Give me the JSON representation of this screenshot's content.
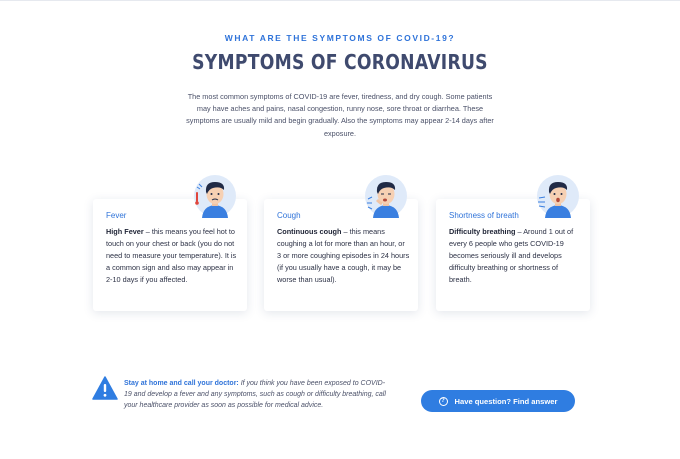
{
  "header": {
    "eyebrow": "WHAT ARE THE SYMPTOMS OF COVID-19?",
    "title": "SYMPTOMS OF CORONAVIRUS",
    "intro": "The most common symptoms of COVID-19 are fever, tiredness, and dry cough. Some patients may have aches and pains, nasal congestion, runny nose, sore throat or diarrhea. These symptoms are usually mild and begin gradually. Also the symptoms may appear 2-14 days after exposure."
  },
  "cards": [
    {
      "title": "Fever",
      "lead": "High Fever",
      "text": " – this means you feel hot to touch on your chest or back (you do not need to measure your temperature). It is a common sign and also may appear in 2-10 days if you affected.",
      "icon": "fever-avatar-icon"
    },
    {
      "title": "Cough",
      "lead": "Continuous cough",
      "text": " – this means coughing a lot for more than an hour, or 3 or more coughing episodes in 24 hours (if you usually have a cough, it may be worse than usual).",
      "icon": "cough-avatar-icon"
    },
    {
      "title": "Shortness of breath",
      "lead": "Difficulty breathing",
      "text": " – Around 1 out of every 6 people who gets COVID-19 becomes seriously ill and develops difficulty breathing or shortness of breath.",
      "icon": "breathing-avatar-icon"
    }
  ],
  "notice": {
    "lead": "Stay at home and call your doctor:",
    "text": " If you think you have been exposed to COVID-19 and develop a fever and any symptoms, such as cough or difficulty breathing, call your healthcare provider as soon as possible for medical advice.",
    "icon": "warning-icon"
  },
  "cta": {
    "label": "Have question? Find answer",
    "icon": "question-circle-icon",
    "icon_glyph": "?"
  },
  "colors": {
    "accent": "#2f73d9",
    "button": "#2f7de1",
    "title": "#3f4a6e"
  }
}
